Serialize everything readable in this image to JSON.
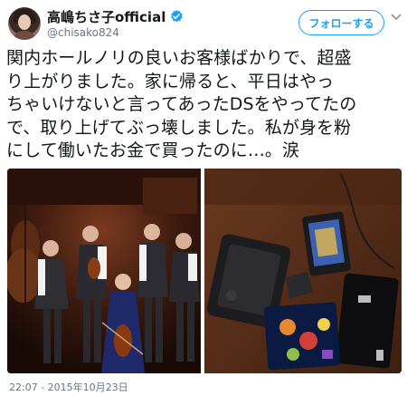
{
  "author": {
    "display_name": "高嶋ちさ子official",
    "handle": "@chisako824",
    "verified": true
  },
  "follow_button_label": "フォローする",
  "tweet_lines": [
    "関内ホールノリの良いお客様ばかりで、超盛",
    "り上がりました。家に帰ると、平日はやっ",
    "ちゃいけないと言ってあったDSをやってたの",
    "で、取り上げてぶっ壊しました。私が身を粉",
    "にして働いたお金で買ったのに…。涙"
  ],
  "photos": [
    {
      "name": "band-photo"
    },
    {
      "name": "broken-ds-photo"
    }
  ],
  "timestamp": "22:07 - 2015年10月23日",
  "colors": {
    "accent": "#1da1f2",
    "text": "#14171a",
    "secondary": "#657786"
  },
  "icons": [
    "verified-icon",
    "chevron-down-icon"
  ]
}
